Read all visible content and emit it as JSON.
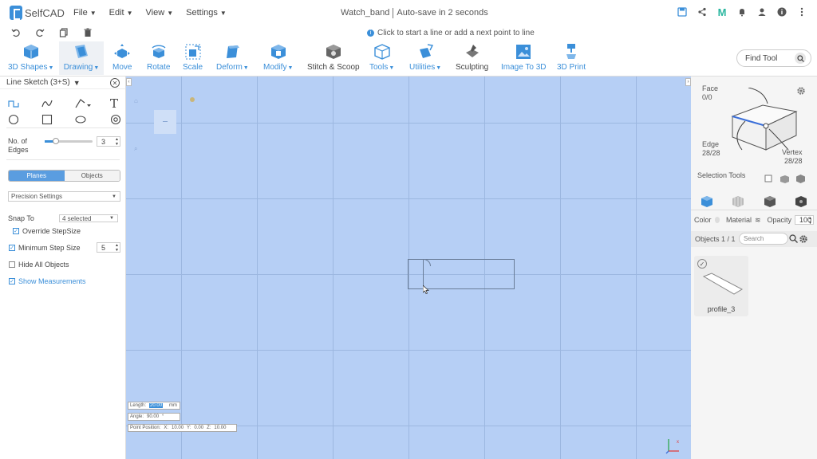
{
  "app": {
    "name": "SelfCAD"
  },
  "menu": [
    {
      "label": "File"
    },
    {
      "label": "Edit"
    },
    {
      "label": "View"
    },
    {
      "label": "Settings"
    }
  ],
  "document": {
    "title": "Watch_band",
    "autosave": "Auto-save in 2 seconds"
  },
  "hint": {
    "text": "Click to start a line or add a next point to line"
  },
  "toolbar": [
    {
      "id": "3d-shapes",
      "label": "3D Shapes",
      "has_menu": true,
      "icon": "cube-icon"
    },
    {
      "id": "drawing",
      "label": "Drawing",
      "has_menu": true,
      "icon": "drawing-icon",
      "active": true
    },
    {
      "id": "move",
      "label": "Move",
      "has_menu": false,
      "icon": "move-icon"
    },
    {
      "id": "rotate",
      "label": "Rotate",
      "has_menu": false,
      "icon": "rotate-icon"
    },
    {
      "id": "scale",
      "label": "Scale",
      "has_menu": false,
      "icon": "scale-icon"
    },
    {
      "id": "deform",
      "label": "Deform",
      "has_menu": true,
      "icon": "deform-icon"
    },
    {
      "id": "modify",
      "label": "Modify",
      "has_menu": true,
      "icon": "modify-icon"
    },
    {
      "id": "stitch",
      "label": "Stitch & Scoop",
      "has_menu": false,
      "icon": "stitch-icon"
    },
    {
      "id": "tools",
      "label": "Tools",
      "has_menu": true,
      "icon": "tools-icon"
    },
    {
      "id": "utilities",
      "label": "Utilities",
      "has_menu": true,
      "icon": "utilities-icon"
    },
    {
      "id": "sculpting",
      "label": "Sculpting",
      "has_menu": false,
      "icon": "sculpting-icon"
    },
    {
      "id": "image-to-3d",
      "label": "Image To 3D",
      "has_menu": false,
      "icon": "image-icon"
    },
    {
      "id": "3d-print",
      "label": "3D Print",
      "has_menu": false,
      "icon": "printer-icon"
    }
  ],
  "find_tool": {
    "placeholder": "Find Tool"
  },
  "left_panel": {
    "title": "Line Sketch (3+S)",
    "edges_label": "No. of Edges",
    "edges_value": "3",
    "edges_fraction": 0.1,
    "tabs": [
      {
        "label": "Planes",
        "active": true
      },
      {
        "label": "Objects",
        "active": false
      }
    ],
    "precision": "Precision Settings",
    "snap_to_label": "Snap To",
    "snap_to_value": "4 selected",
    "override_step": "Override StepSize",
    "min_step_label": "Minimum Step Size",
    "min_step_value": "5",
    "hide_all": "Hide All Objects",
    "show_measurements": "Show Measurements"
  },
  "measurements": {
    "length_label": "Length:",
    "length_value": "20.00",
    "length_unit": "mm",
    "angle_label": "Angle:",
    "angle_value": "90.00",
    "angle_unit": "°",
    "point_label": "Point Position:",
    "x_label": "X:",
    "x": "10.00",
    "y_label": "Y:",
    "y": "0.00",
    "z_label": "Z:",
    "z": "10.00"
  },
  "right_panel": {
    "face_label": "Face",
    "face_value": "0/0",
    "edge_label": "Edge",
    "edge_value": "28/28",
    "vertex_label": "Vertex",
    "vertex_value": "28/28",
    "selection_tools": "Selection Tools",
    "color_label": "Color",
    "material_label": "Material",
    "opacity_label": "Opacity",
    "opacity_value": "100",
    "objects_label": "Objects 1 / 1",
    "search_placeholder": "Search",
    "objects": [
      {
        "name": "profile_3",
        "selected": true
      }
    ]
  },
  "colors": {
    "accent": "#3b8fd9",
    "viewport": "#b6cff5",
    "grid": "#9cb7e0"
  }
}
